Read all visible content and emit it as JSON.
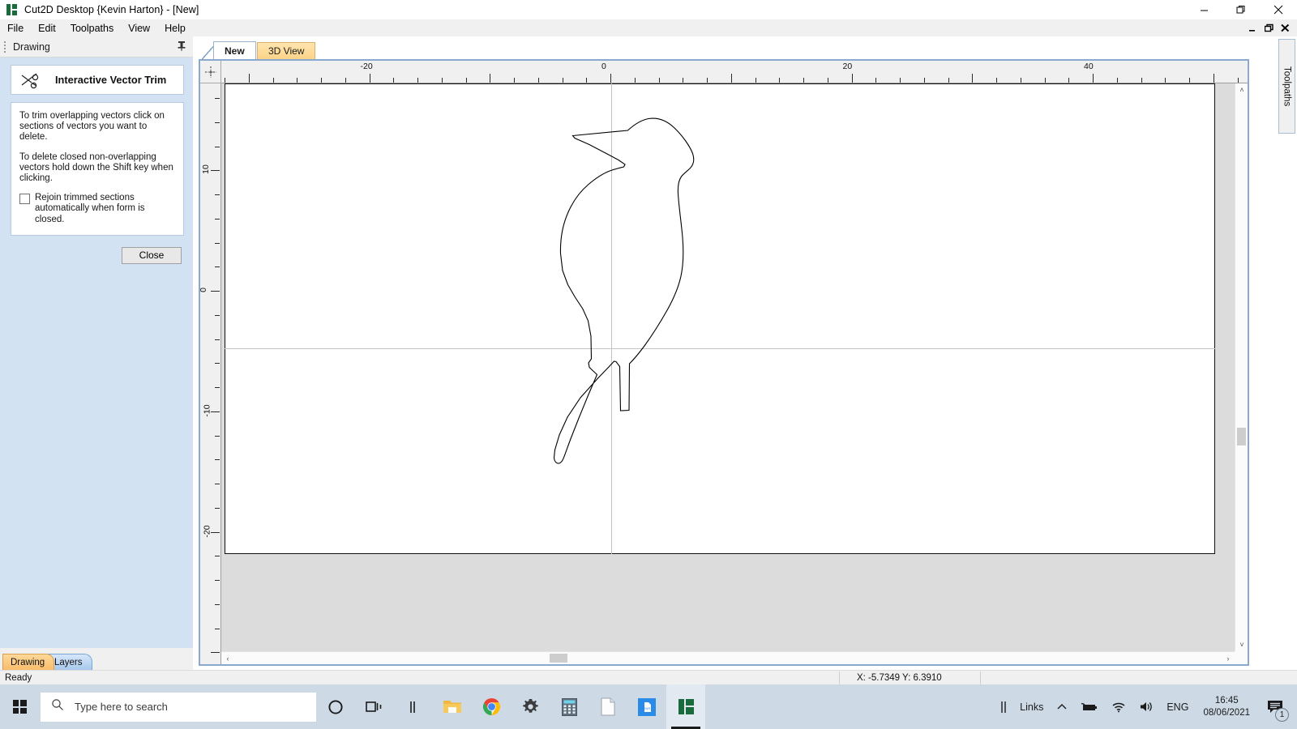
{
  "window": {
    "title": "Cut2D Desktop {Kevin Harton} - [New]",
    "icon": "vectric-logo-icon",
    "minimize": "minimize-icon",
    "maximize": "restore-icon",
    "close": "close-icon"
  },
  "menu": {
    "items": [
      {
        "label": "File"
      },
      {
        "label": "Edit"
      },
      {
        "label": "Toolpaths"
      },
      {
        "label": "View"
      },
      {
        "label": "Help"
      }
    ],
    "mdi": {
      "minimize": "_",
      "restore": "❐",
      "close": "✕"
    }
  },
  "left_panel": {
    "header_title": "Drawing",
    "pin_icon": "pin-icon",
    "form": {
      "icon": "scissors-trim-icon",
      "title": "Interactive Vector Trim"
    },
    "help": {
      "paragraph1": "To trim overlapping vectors click on sections of vectors you want to delete.",
      "paragraph2": "To delete closed non-overlapping vectors hold down the Shift key when clicking.",
      "checkbox_label": "Rejoin trimmed sections automatically when form is closed.",
      "checkbox_checked": false
    },
    "close_button": "Close",
    "bottom_tabs": [
      {
        "label": "Drawing",
        "selected": true
      },
      {
        "label": "Layers",
        "selected": false
      }
    ]
  },
  "document": {
    "tabs": [
      {
        "label": "New",
        "selected": true
      },
      {
        "label": "3D View",
        "selected": false
      }
    ],
    "side_tab": "Toolpaths",
    "ruler": {
      "h_labels": [
        "-20",
        "0",
        "20",
        "40"
      ],
      "v_labels": [
        "10",
        "0",
        "-10",
        "-20"
      ],
      "minor_tick_units": 2,
      "major_tick_units": 10,
      "units_per_label": 20
    },
    "scroll": {
      "left_arrow": "‹",
      "right_arrow": "›",
      "up_arrow": "˄",
      "down_arrow": "˅"
    }
  },
  "drawing": {
    "name": "bird-vector-outline",
    "body_path": "M 706.5 192.5 L 774.5 186.0 C 781.5 179.5 790.0 173.5 800.0 171.5 C 812.0 169.5 822.5 174.0 831.5 182.5 C 842.0 192.5 850.5 204.5 854.5 214.5 C 857.0 222.0 855.5 228.5 851.0 233.0 C 847.5 236.5 843.5 239.0 840.5 243.0 C 837.0 248.0 836.0 255.0 836.5 264.0 C 837.5 281.0 840.5 300.0 842.0 318.0 C 843.5 336.0 843.0 352.0 840.0 366.0 C 836.5 382.0 830.0 395.5 823.0 408.0 C 814.0 424.0 804.0 439.5 795.0 452.0 C 788.0 461.5 782.0 468.5 776.5 474.0 L 776.0 531.5 L 765.5 532.0 L 764.5 477.5 L 760.0 471.5 L 757.5 471.0 L 752.0 477.0 L 738.0 491.5 L 716.0 516.0 L 700.0 540.0 L 690.0 562.0 L 684.5 580.5 L 683.5 590.0 C 684.0 595.0 686.5 597.5 689.5 597.0 C 692.5 596.5 694.5 593.0 696.0 588.5 L 703.5 568.0 L 714.5 540.0 L 726.0 512.0 L 736.5 487.5 L 727.0 478.5 L 726.0 473.0 L 729.5 468.0 L 729.0 440.0 L 725.5 421.0 L 719.0 406.5 L 709.5 392.0 L 700.5 376.5 L 694.0 359.0 L 691.5 338.0 C 691.0 320.0 694.0 303.0 700.5 288.0 C 706.5 274.0 715.0 262.0 725.5 253.0 C 735.5 244.5 745.0 238.5 753.5 235.5 C 760.5 233.0 766.0 232.0 769.5 231.0 L 771.0 228.0 L 763.0 222.5 L 748.0 214.5 L 727.0 203.5 L 709.0 195.5 Z",
    "stroke": "#000000",
    "fill": "none"
  },
  "status": {
    "ready": "Ready",
    "coords": "X: -5.7349 Y:  6.3910"
  },
  "taskbar": {
    "start_icon": "windows-start-icon",
    "search_placeholder": "Type here to search",
    "search_icon": "search-icon",
    "icons": [
      {
        "name": "cortana-icon"
      },
      {
        "name": "task-view-icon"
      },
      {
        "name": "columns-icon"
      },
      {
        "name": "file-explorer-icon"
      },
      {
        "name": "chrome-icon"
      },
      {
        "name": "settings-gear-icon"
      },
      {
        "name": "calculator-icon"
      },
      {
        "name": "document-icon"
      },
      {
        "name": "blue-app-icon"
      },
      {
        "name": "vectric-cut2d-icon"
      }
    ],
    "tray": {
      "links_label": "Links",
      "chevron": "chevron-up-icon",
      "battery": "battery-icon",
      "wifi": "wifi-icon",
      "volume": "speaker-icon",
      "language": "ENG",
      "time": "16:45",
      "date": "08/06/2021",
      "notification_count": "1"
    }
  },
  "colors": {
    "panel_blue": "#d3e2f2",
    "tab_orange": "#f8bd6b",
    "frame_blue": "#89a9cf",
    "taskbar": "#cdd9e5",
    "canvas_gray": "#dcdcdc",
    "vectric_green": "#1a6b3c"
  }
}
